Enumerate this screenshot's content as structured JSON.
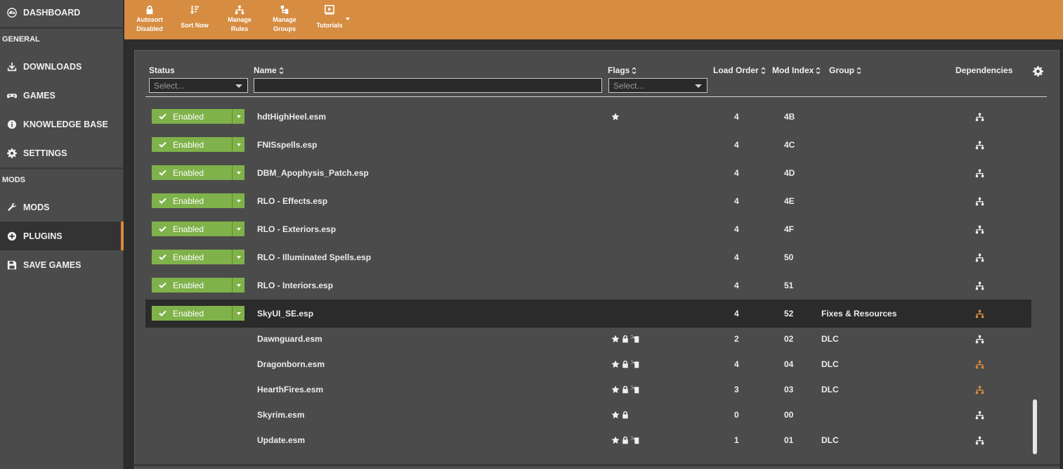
{
  "sidebar": {
    "dashboard": "DASHBOARD",
    "section_general": "GENERAL",
    "downloads": "DOWNLOADS",
    "games": "GAMES",
    "knowledge_base": "KNOWLEDGE BASE",
    "settings": "SETTINGS",
    "section_mods": "MODS",
    "mods": "MODS",
    "plugins": "PLUGINS",
    "save_games": "SAVE GAMES"
  },
  "toolbar": {
    "autosort_line1": "Autosort",
    "autosort_line2": "Disabled",
    "sort_now": "Sort Now",
    "manage_rules_line1": "Manage",
    "manage_rules_line2": "Rules",
    "manage_groups_line1": "Manage",
    "manage_groups_line2": "Groups",
    "tutorials": "Tutorials"
  },
  "table": {
    "headers": {
      "status": "Status",
      "name": "Name",
      "flags": "Flags",
      "load_order": "Load Order",
      "mod_index": "Mod Index",
      "group": "Group",
      "dependencies": "Dependencies"
    },
    "status_filter_placeholder": "Select...",
    "flags_filter_placeholder": "Select...",
    "name_filter_value": "",
    "rows": [
      {
        "status": "Enabled",
        "name": "hdtHighHeel.esm",
        "flags": [
          "star"
        ],
        "load_order": "4",
        "mod_index": "4B",
        "group": "",
        "dep_color": "#f0f0f0"
      },
      {
        "status": "Enabled",
        "name": "FNISspells.esp",
        "flags": [],
        "load_order": "4",
        "mod_index": "4C",
        "group": "",
        "dep_color": "#f0f0f0"
      },
      {
        "status": "Enabled",
        "name": "DBM_Apophysis_Patch.esp",
        "flags": [],
        "load_order": "4",
        "mod_index": "4D",
        "group": "",
        "dep_color": "#f0f0f0"
      },
      {
        "status": "Enabled",
        "name": "RLO - Effects.esp",
        "flags": [],
        "load_order": "4",
        "mod_index": "4E",
        "group": "",
        "dep_color": "#f0f0f0"
      },
      {
        "status": "Enabled",
        "name": "RLO - Exteriors.esp",
        "flags": [],
        "load_order": "4",
        "mod_index": "4F",
        "group": "",
        "dep_color": "#f0f0f0"
      },
      {
        "status": "Enabled",
        "name": "RLO - Illuminated Spells.esp",
        "flags": [],
        "load_order": "4",
        "mod_index": "50",
        "group": "",
        "dep_color": "#f0f0f0"
      },
      {
        "status": "Enabled",
        "name": "RLO - Interiors.esp",
        "flags": [],
        "load_order": "4",
        "mod_index": "51",
        "group": "",
        "dep_color": "#f0f0f0"
      },
      {
        "status": "Enabled",
        "name": "SkyUI_SE.esp",
        "flags": [],
        "load_order": "4",
        "mod_index": "52",
        "group": "Fixes & Resources",
        "dep_color": "#d98a3c"
      },
      {
        "status": "",
        "name": "Dawnguard.esm",
        "flags": [
          "star",
          "lock",
          "clean"
        ],
        "load_order": "2",
        "mod_index": "02",
        "group": "DLC",
        "dep_color": "#f0f0f0"
      },
      {
        "status": "",
        "name": "Dragonborn.esm",
        "flags": [
          "star",
          "lock",
          "clean"
        ],
        "load_order": "4",
        "mod_index": "04",
        "group": "DLC",
        "dep_color": "#d98a3c"
      },
      {
        "status": "",
        "name": "HearthFires.esm",
        "flags": [
          "star",
          "lock",
          "clean"
        ],
        "load_order": "3",
        "mod_index": "03",
        "group": "DLC",
        "dep_color": "#d98a3c"
      },
      {
        "status": "",
        "name": "Skyrim.esm",
        "flags": [
          "star",
          "lock"
        ],
        "load_order": "0",
        "mod_index": "00",
        "group": "",
        "dep_color": "#f0f0f0"
      },
      {
        "status": "",
        "name": "Update.esm",
        "flags": [
          "star",
          "lock",
          "clean"
        ],
        "load_order": "1",
        "mod_index": "01",
        "group": "DLC",
        "dep_color": "#f0f0f0"
      }
    ]
  },
  "colors": {
    "accent": "#d68d42",
    "enabled": "#7fb24a",
    "dependency_warning": "#d98a3c"
  }
}
